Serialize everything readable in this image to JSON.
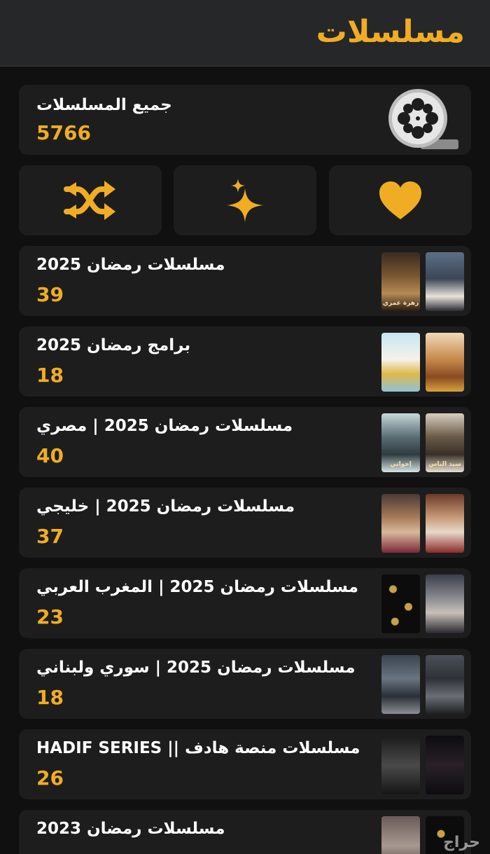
{
  "header": {
    "title": "مسلسلات"
  },
  "all_series": {
    "title": "جميع المسلسلات",
    "count": "5766",
    "icon": "film-reel-icon"
  },
  "actions": [
    {
      "name": "shuffle",
      "icon": "shuffle-icon"
    },
    {
      "name": "featured",
      "icon": "sparkle-icon"
    },
    {
      "name": "favorites",
      "icon": "heart-icon"
    }
  ],
  "categories": [
    {
      "title": "مسلسلات رمضان 2025",
      "count": "39",
      "posters": [
        "",
        "زهرة عمري"
      ]
    },
    {
      "title": "برامج رمضان 2025",
      "count": "18",
      "posters": [
        "",
        ""
      ]
    },
    {
      "title": "مسلسلات رمضان 2025 | مصري",
      "count": "40",
      "posters": [
        "سيد الناس",
        "إخواتي"
      ]
    },
    {
      "title": "مسلسلات رمضان 2025 | خليجي",
      "count": "37",
      "posters": [
        "",
        ""
      ]
    },
    {
      "title": "مسلسلات رمضان 2025 | المغرب العربي",
      "count": "23",
      "posters": [
        "",
        ""
      ]
    },
    {
      "title": "مسلسلات رمضان 2025 | سوري ولبناني",
      "count": "18",
      "posters": [
        "",
        ""
      ]
    },
    {
      "title": "مسلسلات منصة هادف || HADIF SERIES",
      "count": "26",
      "posters": [
        "",
        ""
      ]
    },
    {
      "title": "مسلسلات رمضان 2023",
      "count": "",
      "posters": [
        "",
        ""
      ]
    }
  ],
  "watermark": "حراج",
  "colors": {
    "accent": "#f0ad24",
    "card": "#1d1d1d",
    "header": "#262728"
  }
}
